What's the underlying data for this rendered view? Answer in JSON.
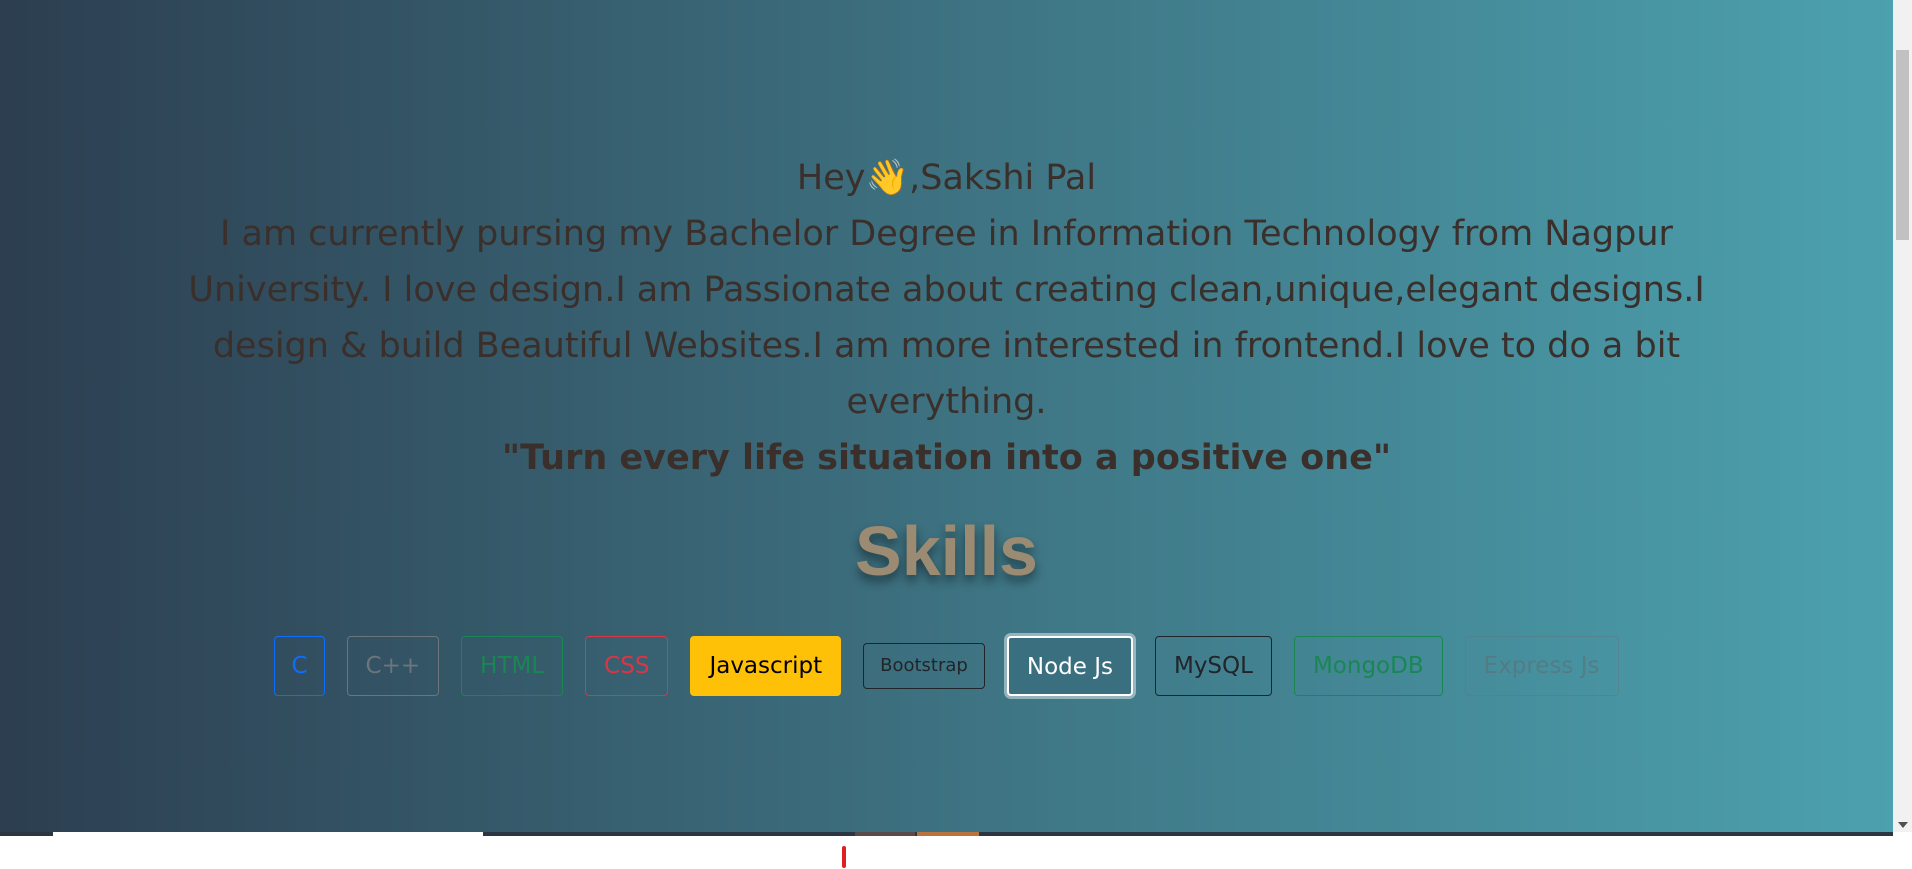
{
  "intro": {
    "greeting_prefix": "Hey",
    "wave_emoji": "👋",
    "greeting_suffix": ",Sakshi Pal",
    "bio": "I am currently pursing my Bachelor Degree in Information Technology from Nagpur University. I love design.I am Passionate about creating clean,unique,elegant designs.I design & build Beautiful Websites.I am more interested in frontend.I love to do a bit everything.",
    "quote": "\"Turn every life situation into a positive one\""
  },
  "skills": {
    "title": "Skills",
    "items": [
      {
        "label": "C"
      },
      {
        "label": "C++"
      },
      {
        "label": "HTML"
      },
      {
        "label": "CSS"
      },
      {
        "label": "Javascript"
      },
      {
        "label": "Bootstrap"
      },
      {
        "label": "Node Js"
      },
      {
        "label": "MySQL"
      },
      {
        "label": "MongoDB"
      },
      {
        "label": "Express Js"
      }
    ]
  },
  "colors": {
    "gradient_start": "#2c3e50",
    "gradient_end": "#4ca1af",
    "text": "#3a2f2a",
    "skills_title": "#9c8b73"
  }
}
